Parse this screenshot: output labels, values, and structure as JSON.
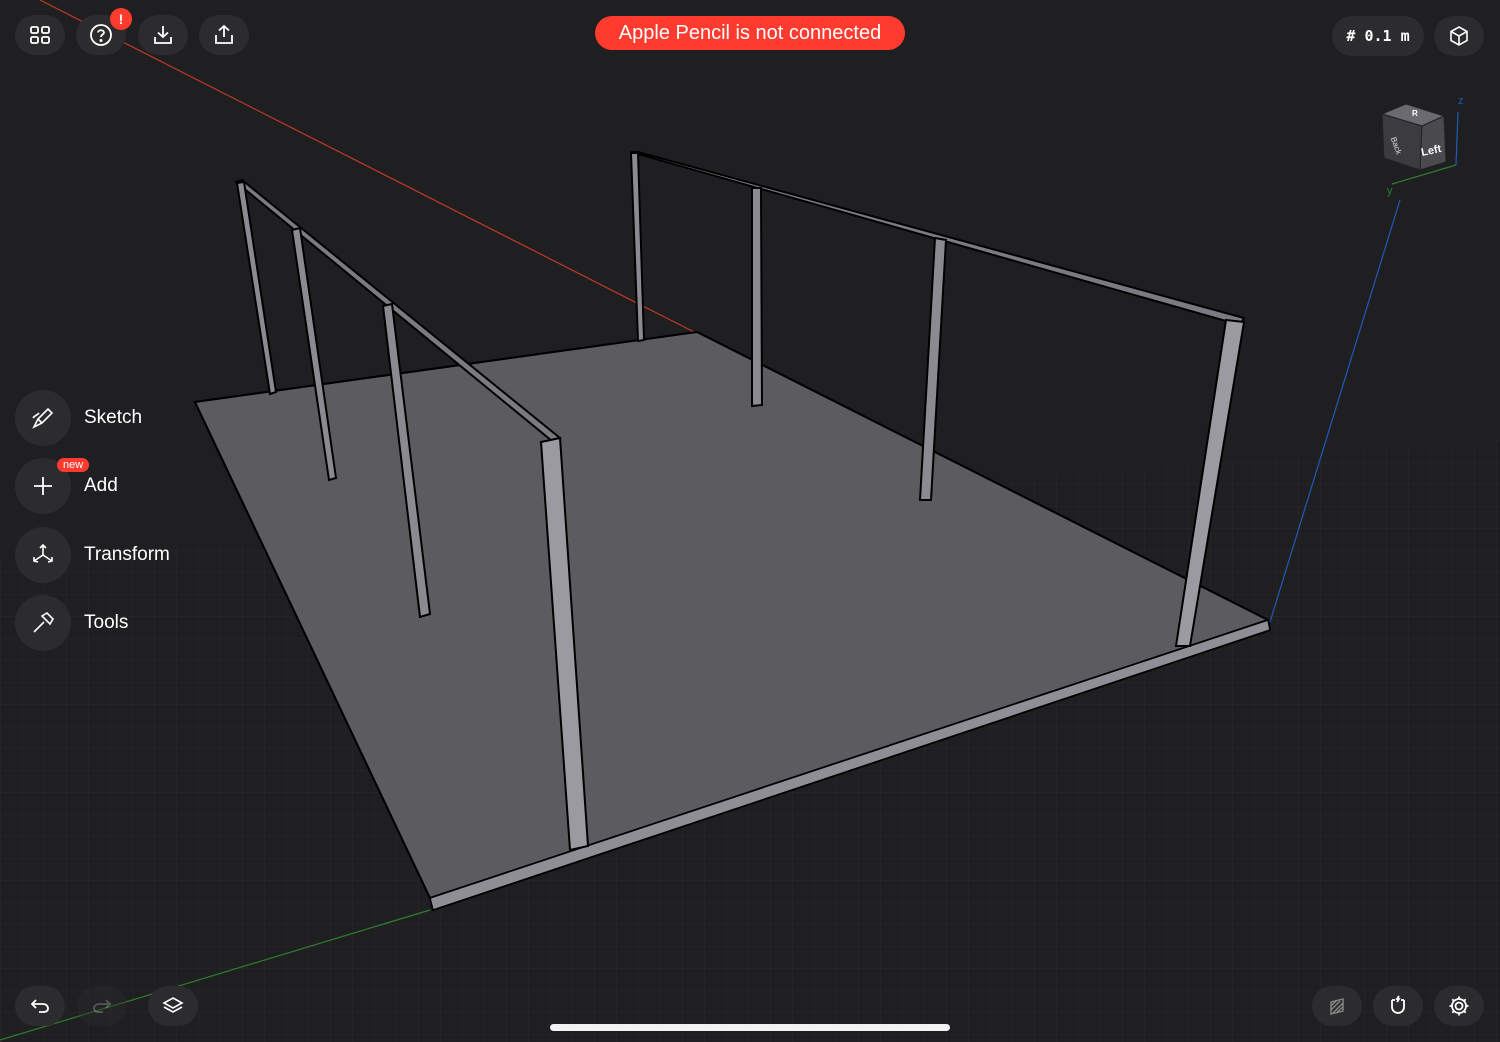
{
  "toolbar": {
    "buttons": [
      {
        "name": "grid-menu",
        "icon": "grid-icon"
      },
      {
        "name": "help",
        "icon": "question-icon"
      },
      {
        "name": "import",
        "icon": "download-icon"
      },
      {
        "name": "export",
        "icon": "share-icon"
      }
    ],
    "help_alert": "!"
  },
  "banner": {
    "text": "Apple Pencil is not connected",
    "color": "#ff3b30"
  },
  "grid": {
    "size_label": "# 0.1 m"
  },
  "viewcube": {
    "face_left": "Left",
    "face_back": "Back",
    "face_top": "R",
    "axis_z": "z",
    "axis_y": "y"
  },
  "side_tools": [
    {
      "label": "Sketch",
      "icon": "pen-icon"
    },
    {
      "label": "Add",
      "icon": "plus-icon",
      "badge": "new"
    },
    {
      "label": "Transform",
      "icon": "transform-icon"
    },
    {
      "label": "Tools",
      "icon": "hammer-icon"
    }
  ],
  "bottom": {
    "left": [
      {
        "name": "undo",
        "icon": "undo-icon"
      },
      {
        "name": "redo",
        "icon": "redo-icon"
      },
      {
        "name": "layers",
        "icon": "layers-icon"
      }
    ],
    "right": [
      {
        "name": "render-mode",
        "icon": "hatch-icon"
      },
      {
        "name": "snapping",
        "icon": "magnet-icon"
      },
      {
        "name": "settings",
        "icon": "gear-icon"
      }
    ]
  },
  "colors": {
    "background": "#1f1f21",
    "button": "#2c2c2e",
    "accent_red": "#ff3b30",
    "axis_x": "#c0392b",
    "axis_y": "#2e7d32",
    "axis_z": "#1e5bb8",
    "model_fill": "#5b5b60"
  }
}
